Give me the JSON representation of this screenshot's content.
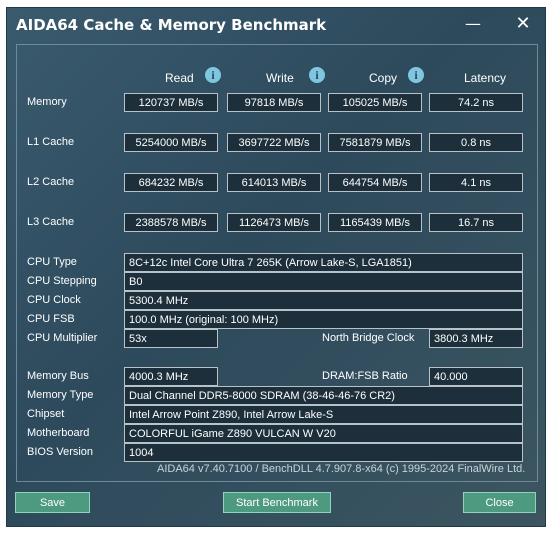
{
  "window": {
    "title": "AIDA64 Cache & Memory Benchmark",
    "minimize": "—",
    "close": "✕"
  },
  "headers": {
    "read": "Read",
    "write": "Write",
    "copy": "Copy",
    "latency": "Latency",
    "info": "i"
  },
  "bench": [
    {
      "label": "Memory",
      "read": "120737 MB/s",
      "write": "97818 MB/s",
      "copy": "105025 MB/s",
      "latency": "74.2 ns"
    },
    {
      "label": "L1 Cache",
      "read": "5254000 MB/s",
      "write": "3697722 MB/s",
      "copy": "7581879 MB/s",
      "latency": "0.8 ns"
    },
    {
      "label": "L2 Cache",
      "read": "684232 MB/s",
      "write": "614013 MB/s",
      "copy": "644754 MB/s",
      "latency": "4.1 ns"
    },
    {
      "label": "L3 Cache",
      "read": "2388578 MB/s",
      "write": "1126473 MB/s",
      "copy": "1165439 MB/s",
      "latency": "16.7 ns"
    }
  ],
  "cpu": {
    "type_label": "CPU Type",
    "type": "8C+12c Intel Core Ultra 7 265K  (Arrow Lake-S, LGA1851)",
    "stepping_label": "CPU Stepping",
    "stepping": "B0",
    "clock_label": "CPU Clock",
    "clock": "5300.4 MHz",
    "fsb_label": "CPU FSB",
    "fsb": "100.0 MHz  (original: 100 MHz)",
    "mult_label": "CPU Multiplier",
    "mult": "53x",
    "nb_label": "North Bridge Clock",
    "nb": "3800.3 MHz"
  },
  "memory": {
    "bus_label": "Memory Bus",
    "bus": "4000.3 MHz",
    "ratio_label": "DRAM:FSB Ratio",
    "ratio": "40.000",
    "type_label": "Memory Type",
    "type": "Dual Channel DDR5-8000 SDRAM  (38-46-46-76 CR2)",
    "chipset_label": "Chipset",
    "chipset": "Intel Arrow Point Z890, Intel Arrow Lake-S",
    "mb_label": "Motherboard",
    "mb": "COLORFUL iGame Z890 VULCAN W V20",
    "bios_label": "BIOS Version",
    "bios": "1004"
  },
  "footer": "AIDA64 v7.40.7100 / BenchDLL 4.7.907.8-x64  (c) 1995-2024 FinalWire Ltd.",
  "buttons": {
    "save": "Save",
    "start": "Start Benchmark",
    "close": "Close"
  }
}
